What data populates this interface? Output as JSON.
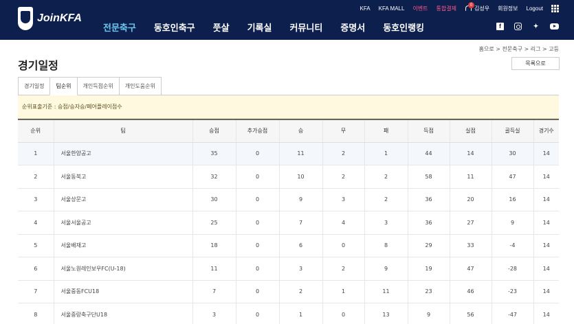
{
  "header": {
    "logo_text": "JoinKFA",
    "utility": {
      "kfa": "KFA",
      "mall": "KFA MALL",
      "event": "이벤트",
      "payment": "통합결제",
      "notification_count": "0",
      "user": "김성우",
      "member_info": "회원정보",
      "logout": "Logout"
    },
    "nav": [
      "전문축구",
      "동호인축구",
      "풋살",
      "기록실",
      "커뮤니티",
      "증명서",
      "동호인랭킹"
    ],
    "social": [
      "facebook-icon",
      "instagram-icon",
      "twitter-icon",
      "youtube-icon"
    ],
    "colors": {
      "background": "#0d1f4d",
      "active_nav": "#6ec6ef",
      "event_link": "#ff5a8a"
    }
  },
  "breadcrumb": "홈으로 > 전문축구 > 리그 > 고등",
  "page": {
    "title": "경기일정",
    "list_button": "목록으로",
    "tabs": [
      "경기일정",
      "팀순위",
      "개인득점순위",
      "개인도움순위"
    ],
    "active_tab": "팀순위",
    "notice": "순위표출기준 : 승점/승자승/페어플레이점수"
  },
  "table": {
    "headers": [
      "순위",
      "팀",
      "승점",
      "추가승점",
      "승",
      "무",
      "패",
      "득점",
      "실점",
      "골득실",
      "경기수"
    ],
    "rows": [
      [
        "1",
        "서울한양공고",
        "35",
        "0",
        "11",
        "2",
        "1",
        "44",
        "14",
        "30",
        "14"
      ],
      [
        "2",
        "서울동북고",
        "32",
        "0",
        "10",
        "2",
        "2",
        "58",
        "11",
        "47",
        "14"
      ],
      [
        "3",
        "서울상문고",
        "30",
        "0",
        "9",
        "3",
        "2",
        "36",
        "20",
        "16",
        "14"
      ],
      [
        "4",
        "서울서울공고",
        "25",
        "0",
        "7",
        "4",
        "3",
        "36",
        "27",
        "9",
        "14"
      ],
      [
        "5",
        "서울배재고",
        "18",
        "0",
        "6",
        "0",
        "8",
        "29",
        "33",
        "-4",
        "14"
      ],
      [
        "6",
        "서울노원레인보우FC(U-18)",
        "11",
        "0",
        "3",
        "2",
        "9",
        "19",
        "47",
        "-28",
        "14"
      ],
      [
        "7",
        "서울중동FCU18",
        "7",
        "0",
        "2",
        "1",
        "11",
        "23",
        "46",
        "-23",
        "14"
      ],
      [
        "8",
        "서울중랑축구단U18",
        "3",
        "0",
        "1",
        "0",
        "13",
        "9",
        "56",
        "-47",
        "14"
      ]
    ]
  }
}
